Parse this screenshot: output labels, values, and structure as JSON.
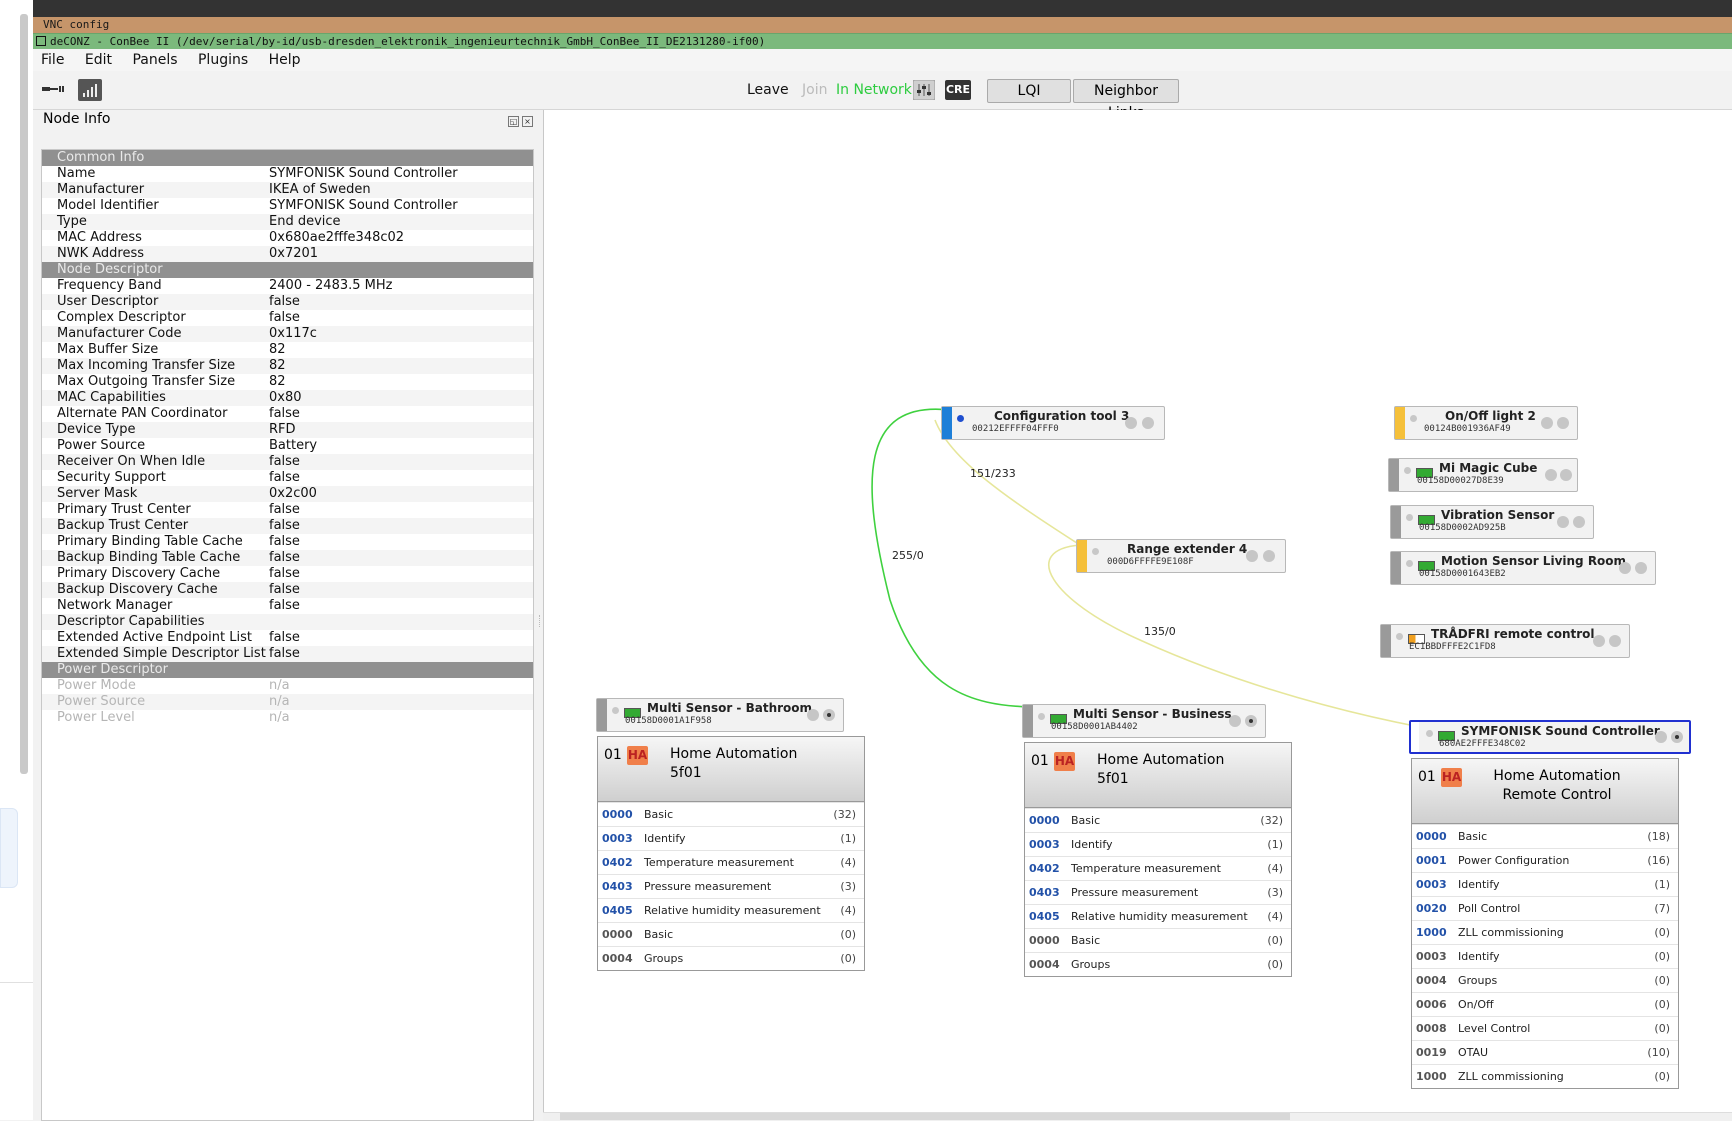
{
  "vnc_title": "VNC config",
  "window_title": "deCONZ - ConBee II (/dev/serial/by-id/usb-dresden_elektronik_ingenieurtechnik_GmbH_ConBee_II_DE2131280-if00)",
  "menu": [
    "File",
    "Edit",
    "Panels",
    "Plugins",
    "Help"
  ],
  "toolbar": {
    "leave": "Leave",
    "join": "Join",
    "status": "In Network",
    "cre": "CRE",
    "lqi": "LQI",
    "neighbor_links": "Neighbor Links",
    "status_color": "#2ecc40"
  },
  "panel": {
    "title": "Node Info",
    "sections": [
      {
        "header": "Common Info",
        "rows": [
          [
            "Name",
            "SYMFONISK Sound Controller"
          ],
          [
            "Manufacturer",
            "IKEA of Sweden"
          ],
          [
            "Model Identifier",
            "SYMFONISK Sound Controller"
          ],
          [
            "Type",
            "End device"
          ],
          [
            "MAC Address",
            "0x680ae2fffe348c02"
          ],
          [
            "NWK Address",
            "0x7201"
          ]
        ]
      },
      {
        "header": "Node Descriptor",
        "rows": [
          [
            "Frequency Band",
            "2400 - 2483.5 MHz"
          ],
          [
            "User Descriptor",
            "false"
          ],
          [
            "Complex Descriptor",
            "false"
          ],
          [
            "Manufacturer Code",
            "0x117c"
          ],
          [
            "Max Buffer Size",
            "82"
          ],
          [
            "Max Incoming Transfer Size",
            "82"
          ],
          [
            "Max Outgoing Transfer Size",
            "82"
          ],
          [
            "MAC Capabilities",
            "0x80"
          ],
          [
            "Alternate PAN Coordinator",
            "false"
          ],
          [
            "Device Type",
            "RFD"
          ],
          [
            "Power Source",
            "Battery"
          ],
          [
            "Receiver On When Idle",
            "false"
          ],
          [
            "Security Support",
            "false"
          ],
          [
            "Server Mask",
            "0x2c00"
          ],
          [
            "Primary Trust Center",
            "false"
          ],
          [
            "Backup Trust Center",
            "false"
          ],
          [
            "Primary Binding Table Cache",
            "false"
          ],
          [
            "Backup Binding Table Cache",
            "false"
          ],
          [
            "Primary Discovery Cache",
            "false"
          ],
          [
            "Backup Discovery Cache",
            "false"
          ],
          [
            "Network Manager",
            "false"
          ],
          [
            "Descriptor Capabilities",
            ""
          ],
          [
            "Extended Active Endpoint List",
            "false"
          ],
          [
            "Extended Simple Descriptor List",
            "false"
          ]
        ]
      },
      {
        "header": "Power Descriptor",
        "disabled": true,
        "rows": [
          [
            "Power Mode",
            "n/a"
          ],
          [
            "Power Source",
            "n/a"
          ],
          [
            "Power Level",
            "n/a"
          ]
        ]
      }
    ]
  },
  "links": {
    "l1": "151/233",
    "l2": "255/0",
    "l3": "135/0"
  },
  "nodes": {
    "config_tool": {
      "name": "Configuration tool 3",
      "addr": "00212EFFFF04FFF0",
      "color": "#1e7fd8"
    },
    "range_ext": {
      "name": "Range extender 4",
      "addr": "000D6FFFFE9E108F",
      "color": "#f5c03a"
    },
    "onoff": {
      "name": "On/Off light 2",
      "addr": "00124B001936AF49",
      "color": "#f5c03a"
    },
    "cube": {
      "name": "Mi Magic Cube",
      "addr": "00158D00027D8E39"
    },
    "vibration": {
      "name": "Vibration Sensor",
      "addr": "00158D0002AD925B"
    },
    "motion": {
      "name": "Motion Sensor Living Room",
      "addr": "00158D0001643EB2"
    },
    "tradfri": {
      "name": "TRÅDFRI remote control",
      "addr": "EC1BBDFFFE2C1FD8"
    },
    "bathroom": {
      "name": "Multi Sensor - Bathroom",
      "addr": "00158D0001A1F958"
    },
    "business": {
      "name": "Multi Sensor - Business",
      "addr": "00158D0001AB4402"
    },
    "symfonisk": {
      "name": "SYMFONISK Sound Controller",
      "addr": "680AE2FFFE348C02"
    }
  },
  "endpoints": {
    "bathroom": {
      "num": "01",
      "profile": "HA",
      "line1": "Home Automation",
      "line2": "5f01",
      "clusters": [
        {
          "id": "0000",
          "name": "Basic",
          "count": "(32)",
          "in": true
        },
        {
          "id": "0003",
          "name": "Identify",
          "count": "(1)",
          "in": true
        },
        {
          "id": "0402",
          "name": "Temperature measurement",
          "count": "(4)",
          "in": true
        },
        {
          "id": "0403",
          "name": "Pressure measurement",
          "count": "(3)",
          "in": true
        },
        {
          "id": "0405",
          "name": "Relative humidity measurement",
          "count": "(4)",
          "in": true
        },
        {
          "id": "0000",
          "name": "Basic",
          "count": "(0)",
          "in": false
        },
        {
          "id": "0004",
          "name": "Groups",
          "count": "(0)",
          "in": false
        }
      ]
    },
    "business": {
      "num": "01",
      "profile": "HA",
      "line1": "Home Automation",
      "line2": "5f01",
      "clusters": [
        {
          "id": "0000",
          "name": "Basic",
          "count": "(32)",
          "in": true
        },
        {
          "id": "0003",
          "name": "Identify",
          "count": "(1)",
          "in": true
        },
        {
          "id": "0402",
          "name": "Temperature measurement",
          "count": "(4)",
          "in": true
        },
        {
          "id": "0403",
          "name": "Pressure measurement",
          "count": "(3)",
          "in": true
        },
        {
          "id": "0405",
          "name": "Relative humidity measurement",
          "count": "(4)",
          "in": true
        },
        {
          "id": "0000",
          "name": "Basic",
          "count": "(0)",
          "in": false
        },
        {
          "id": "0004",
          "name": "Groups",
          "count": "(0)",
          "in": false
        }
      ]
    },
    "symfonisk": {
      "num": "01",
      "profile": "HA",
      "line1": "Home Automation",
      "line2": "Remote Control",
      "clusters": [
        {
          "id": "0000",
          "name": "Basic",
          "count": "(18)",
          "in": true
        },
        {
          "id": "0001",
          "name": "Power Configuration",
          "count": "(16)",
          "in": true
        },
        {
          "id": "0003",
          "name": "Identify",
          "count": "(1)",
          "in": true
        },
        {
          "id": "0020",
          "name": "Poll Control",
          "count": "(7)",
          "in": true
        },
        {
          "id": "1000",
          "name": "ZLL commissioning",
          "count": "(0)",
          "in": true
        },
        {
          "id": "0003",
          "name": "Identify",
          "count": "(0)",
          "in": false
        },
        {
          "id": "0004",
          "name": "Groups",
          "count": "(0)",
          "in": false
        },
        {
          "id": "0006",
          "name": "On/Off",
          "count": "(0)",
          "in": false
        },
        {
          "id": "0008",
          "name": "Level Control",
          "count": "(0)",
          "in": false
        },
        {
          "id": "0019",
          "name": "OTAU",
          "count": "(10)",
          "in": false
        },
        {
          "id": "1000",
          "name": "ZLL commissioning",
          "count": "(0)",
          "in": false
        }
      ]
    }
  }
}
